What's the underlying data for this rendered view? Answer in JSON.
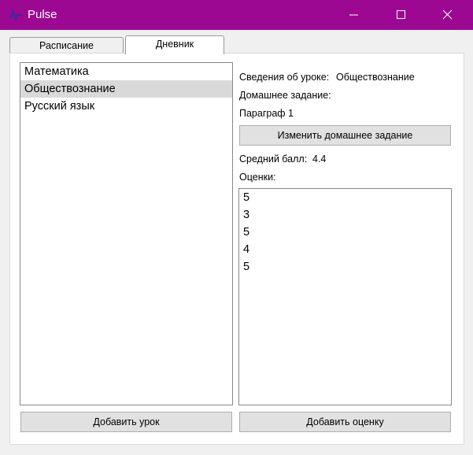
{
  "window": {
    "title": "Pulse",
    "accent_color": "#9c0891"
  },
  "tabs": [
    {
      "label": "Расписание",
      "active": false
    },
    {
      "label": "Дневник",
      "active": true
    }
  ],
  "lessons": {
    "items": [
      "Математика",
      "Обществознание",
      "Русский язык"
    ],
    "selected": "Обществознание"
  },
  "lesson_info": {
    "details_label": "Сведения об уроке:",
    "details_value": "Обществознание",
    "homework_label": "Домашнее задание:",
    "homework_value": "Параграф 1",
    "change_homework_button": "Изменить домашнее задание",
    "average_label": "Средний балл:",
    "average_value": "4.4",
    "grades_label": "Оценки:"
  },
  "grades": [
    "5",
    "3",
    "5",
    "4",
    "5"
  ],
  "buttons": {
    "add_lesson": "Добавить урок",
    "add_grade": "Добавить оценку"
  }
}
